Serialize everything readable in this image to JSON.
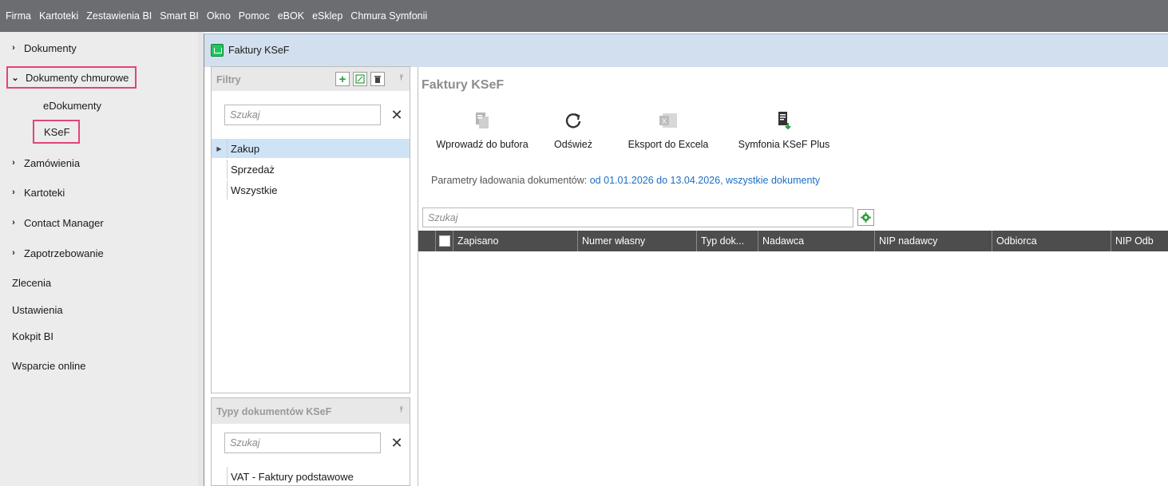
{
  "menu": [
    "Firma",
    "Kartoteki",
    "Zestawienia BI",
    "Smart BI",
    "Okno",
    "Pomoc",
    "eBOK",
    "eSklep",
    "Chmura Symfonii"
  ],
  "nav": {
    "items": [
      {
        "label": "Dokumenty",
        "chevron": "›"
      },
      {
        "label": "Dokumenty chmurowe",
        "chevron": "⌄"
      },
      {
        "label": "eDokumenty"
      },
      {
        "label": "KSeF"
      },
      {
        "label": "Zamówienia",
        "chevron": "›"
      },
      {
        "label": "Kartoteki",
        "chevron": "›"
      },
      {
        "label": "Contact Manager",
        "chevron": "›"
      },
      {
        "label": "Zapotrzebowanie",
        "chevron": "›"
      },
      {
        "label": "Zlecenia"
      },
      {
        "label": "Ustawienia"
      },
      {
        "label": "Kokpit BI"
      },
      {
        "label": "Wsparcie online"
      }
    ],
    "highlight_color": "#e0457b"
  },
  "window": {
    "title": "Faktury KSeF"
  },
  "filters": {
    "title": "Filtry",
    "search_placeholder": "Szukaj",
    "items": [
      "Zakup",
      "Sprzedaż",
      "Wszystkie"
    ],
    "selected": "Zakup"
  },
  "doc_types": {
    "title": "Typy dokumentów KSeF",
    "search_placeholder": "Szukaj",
    "items": [
      "VAT - Faktury podstawowe"
    ]
  },
  "main": {
    "title": "Faktury KSeF",
    "actions": [
      {
        "label": "Wprowadź do bufora",
        "icon": "document-to-buffer-icon"
      },
      {
        "label": "Odśwież",
        "icon": "refresh-icon"
      },
      {
        "label": "Eksport do Excela",
        "icon": "excel-export-icon"
      },
      {
        "label": "Symfonia KSeF Plus",
        "icon": "ksef-plus-icon"
      }
    ],
    "params_label": "Parametry ładowania dokumentów:",
    "params_value": "od 01.01.2026 do 13.04.2026, wszystkie dokumenty",
    "grid_search_placeholder": "Szukaj",
    "columns": [
      "Zapisano",
      "Numer własny",
      "Typ dok...",
      "Nadawca",
      "NIP nadawcy",
      "Odbiorca",
      "NIP Odb"
    ]
  },
  "colors": {
    "menubar": "#6b6d71",
    "link": "#1a6fc4",
    "grid_header": "#4d4d4d",
    "selected_row": "#cfe3f7",
    "accent_green": "#22c55e"
  }
}
